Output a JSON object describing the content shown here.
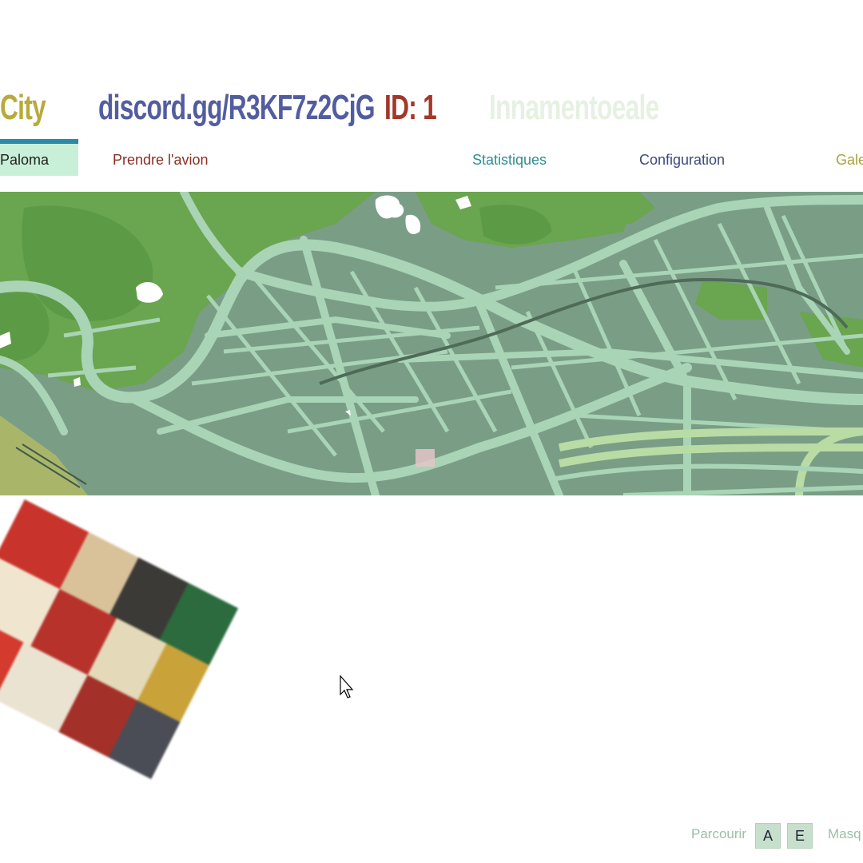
{
  "header": {
    "city": "City",
    "discord": "discord.gg/R3KF7z2CjG",
    "id": "ID: 1",
    "faded": "Innamentoeale"
  },
  "tabs": {
    "active": "Paloma",
    "fly": "Prendre l'avion",
    "stats": "Statistiques",
    "config": "Configuration",
    "gallery": "Gale"
  },
  "footer": {
    "browse": "Parcourir",
    "key_a": "A",
    "key_e": "E",
    "hide": "Masq"
  },
  "colors": {
    "map_block": "#7a9d86",
    "map_road": "#a9d4b6",
    "map_green": "#6aa54f",
    "map_dark_green": "#5c9a46",
    "tab_active_bg": "#c8efd7",
    "tab_active_bar": "#2b8aa5"
  },
  "icons": {
    "cursor": "mouse-pointer-icon"
  }
}
